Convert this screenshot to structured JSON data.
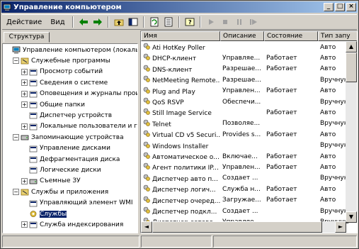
{
  "window": {
    "title": "Управление компьютером"
  },
  "menu": {
    "action": "Действие",
    "view": "Вид"
  },
  "tab": {
    "label": "Структура"
  },
  "tree": [
    {
      "label": "Управление компьютером (локальным)",
      "level": 0,
      "expander": ""
    },
    {
      "label": "Служебные программы",
      "level": 1,
      "expander": "−"
    },
    {
      "label": "Просмотр событий",
      "level": 2,
      "expander": "+"
    },
    {
      "label": "Сведения о системе",
      "level": 2,
      "expander": "+"
    },
    {
      "label": "Оповещения и журналы произв",
      "level": 2,
      "expander": "+"
    },
    {
      "label": "Общие папки",
      "level": 2,
      "expander": "+"
    },
    {
      "label": "Диспетчер устройств",
      "level": 2,
      "expander": ""
    },
    {
      "label": "Локальные пользователи и гру",
      "level": 2,
      "expander": "+"
    },
    {
      "label": "Запоминающие устройства",
      "level": 1,
      "expander": "−"
    },
    {
      "label": "Управление дисками",
      "level": 2,
      "expander": ""
    },
    {
      "label": "Дефрагментация диска",
      "level": 2,
      "expander": ""
    },
    {
      "label": "Логические диски",
      "level": 2,
      "expander": ""
    },
    {
      "label": "Съемные ЗУ",
      "level": 2,
      "expander": "+"
    },
    {
      "label": "Службы и приложения",
      "level": 1,
      "expander": "−"
    },
    {
      "label": "Управляющий элемент WMI",
      "level": 2,
      "expander": ""
    },
    {
      "label": "Службы",
      "level": 2,
      "expander": "",
      "selected": true
    },
    {
      "label": "Служба индексирования",
      "level": 2,
      "expander": "+"
    }
  ],
  "columns": [
    "Имя",
    "Описание",
    "Состояние",
    "Тип запу"
  ],
  "services": [
    [
      "Ati HotKey Poller",
      "",
      "",
      "Авто"
    ],
    [
      "DHCP-клиент",
      "Управляе...",
      "Работает",
      "Авто"
    ],
    [
      "DNS-клиент",
      "Разрешае...",
      "Работает",
      "Авто"
    ],
    [
      "NetMeeting Remote...",
      "Разрешае...",
      "",
      "Вручную"
    ],
    [
      "Plug and Play",
      "Управлен...",
      "Работает",
      "Авто"
    ],
    [
      "QoS RSVP",
      "Обеспечи...",
      "",
      "Вручную"
    ],
    [
      "Still Image Service",
      "",
      "Работает",
      "Авто"
    ],
    [
      "Telnet",
      "Позволяе...",
      "",
      "Вручную"
    ],
    [
      "Virtual CD v5 Securi...",
      "Provides s...",
      "Работает",
      "Авто"
    ],
    [
      "Windows Installer",
      "",
      "",
      "Вручную"
    ],
    [
      "Автоматическое о...",
      "Включае...",
      "Работает",
      "Авто"
    ],
    [
      "Агент политики IP...",
      "Управлен...",
      "Работает",
      "Авто"
    ],
    [
      "Диспетчер авто п...",
      "Создает ...",
      "",
      "Вручную"
    ],
    [
      "Диспетчер логич...",
      "Служба н...",
      "Работает",
      "Авто"
    ],
    [
      "Диспетчер очеред...",
      "Загружае...",
      "Работает",
      "Авто"
    ],
    [
      "Диспетчер подкл...",
      "Создает ...",
      "",
      "Вручную"
    ],
    [
      "Диспетчер сетево...",
      "Управляе...",
      "",
      "Вручную"
    ]
  ],
  "icons": {
    "back": "arrow-left-icon",
    "forward": "arrow-right-icon",
    "up": "up-folder-icon",
    "show-tree": "show-tree-icon",
    "refresh": "refresh-icon",
    "export": "export-icon",
    "help": "help-icon",
    "play": "play-icon",
    "stop": "stop-icon",
    "pause": "pause-icon",
    "restart": "restart-icon"
  }
}
